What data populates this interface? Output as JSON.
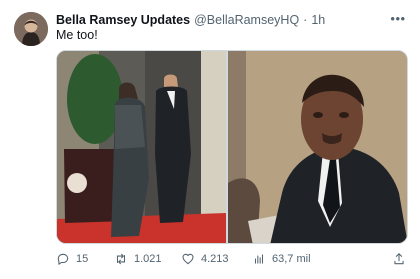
{
  "tweet": {
    "display_name": "Bella Ramsey Updates",
    "handle": "@BellaRamseyHQ",
    "separator": "·",
    "time": "1h",
    "text": "Me too!",
    "more_label": "•••"
  },
  "media": {
    "left_image_icon": "photo-image",
    "right_image_icon": "photo-image"
  },
  "actions": {
    "replies": "15",
    "reposts": "1.021",
    "likes": "4.213",
    "views": "63,7 mil"
  },
  "colors": {
    "muted": "#536471",
    "text": "#0f1419",
    "border": "#cfd9de"
  }
}
